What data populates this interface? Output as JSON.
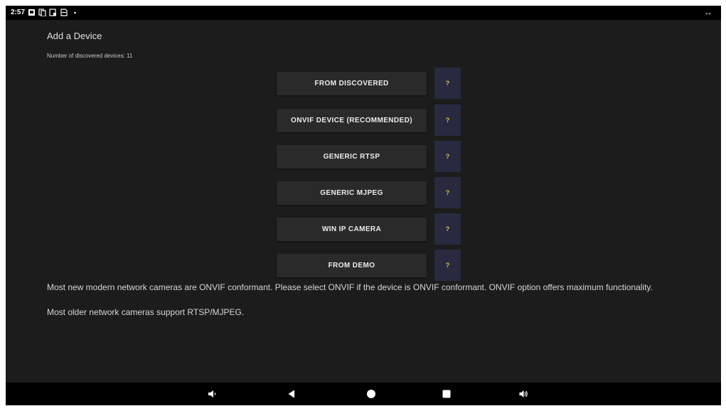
{
  "status_bar": {
    "time": "2:57",
    "icons": [
      "notification-square-icon",
      "copy-icon",
      "screenshot-icon",
      "sim-icon",
      "dot-icon"
    ],
    "right_icon": "rotate-icon"
  },
  "page": {
    "title": "Add a Device",
    "discovered_count": "Number of discovered devices: 11"
  },
  "options": [
    {
      "label": "FROM DISCOVERED",
      "help": "?"
    },
    {
      "label": "ONVIF DEVICE (RECOMMENDED)",
      "help": "?"
    },
    {
      "label": "GENERIC RTSP",
      "help": "?"
    },
    {
      "label": "GENERIC MJPEG",
      "help": "?"
    },
    {
      "label": "WIN IP CAMERA",
      "help": "?"
    },
    {
      "label": "FROM DEMO",
      "help": "?"
    }
  ],
  "info": {
    "line1": "Most new modern network cameras are ONVIF conformant. Please select ONVIF if the device is ONVIF conformant. ONVIF option offers maximum functionality.",
    "line2": "Most older network cameras support RTSP/MJPEG."
  },
  "nav_bar": {
    "icons": [
      "volume-down-icon",
      "back-icon",
      "home-icon",
      "recents-icon",
      "volume-up-icon"
    ]
  },
  "colors": {
    "background": "#1c1c1c",
    "button": "#2a2a2a",
    "help_button": "#282a40",
    "help_text": "#d8c24a"
  }
}
